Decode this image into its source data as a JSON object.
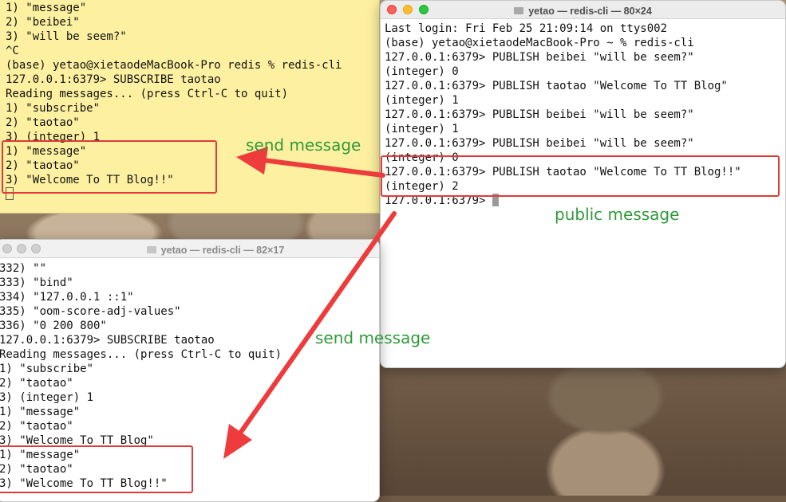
{
  "yellow_terminal": {
    "lines": [
      "1) \"message\"",
      "2) \"beibei\"",
      "3) \"will be seem?\"",
      "^C",
      "(base) yetao@xietaodeMacBook-Pro redis % redis-cli",
      "127.0.0.1:6379> SUBSCRIBE taotao",
      "Reading messages... (press Ctrl-C to quit)",
      "1) \"subscribe\"",
      "2) \"taotao\"",
      "3) (integer) 1",
      "1) \"message\"",
      "2) \"taotao\"",
      "3) \"Welcome To TT Blog!!\""
    ]
  },
  "right_terminal": {
    "title": "yetao — redis-cli — 80×24",
    "lines": [
      "Last login: Fri Feb 25 21:09:14 on ttys002",
      "(base) yetao@xietaodeMacBook-Pro ~ % redis-cli",
      "127.0.0.1:6379> PUBLISH beibei \"will be seem?\"",
      "(integer) 0",
      "127.0.0.1:6379> PUBLISH taotao \"Welcome To TT Blog\"",
      "(integer) 1",
      "127.0.0.1:6379> PUBLISH beibei \"will be seem?\"",
      "(integer) 1",
      "127.0.0.1:6379> PUBLISH beibei \"will be seem?\"",
      "(integer) 0",
      "127.0.0.1:6379> PUBLISH taotao \"Welcome To TT Blog!!\"",
      "(integer) 2"
    ],
    "prompt": "127.0.0.1:6379> "
  },
  "bottom_terminal": {
    "title": "yetao — redis-cli — 82×17",
    "lines": [
      "332) \"\"",
      "333) \"bind\"",
      "334) \"127.0.0.1 ::1\"",
      "335) \"oom-score-adj-values\"",
      "336) \"0 200 800\"",
      "127.0.0.1:6379> SUBSCRIBE taotao",
      "Reading messages... (press Ctrl-C to quit)",
      "1) \"subscribe\"",
      "2) \"taotao\"",
      "3) (integer) 1",
      "1) \"message\"",
      "2) \"taotao\"",
      "3) \"Welcome To TT Blog\"",
      "1) \"message\"",
      "2) \"taotao\"",
      "3) \"Welcome To TT Blog!!\""
    ]
  },
  "annotations": {
    "send_message_top": "send message",
    "public_message": "public message",
    "send_message_middle": "send message"
  },
  "colors": {
    "annotation_text": "#2f9a3a",
    "highlight": "#e03a3a",
    "terminal_yellow_bg": "#fdf0a0",
    "close": "#fe5f57",
    "minimize": "#febc2e",
    "zoom": "#28c840"
  },
  "icons": {
    "folder": "folder-icon",
    "close": "close-button",
    "minimize": "minimize-button",
    "zoom": "zoom-button"
  }
}
